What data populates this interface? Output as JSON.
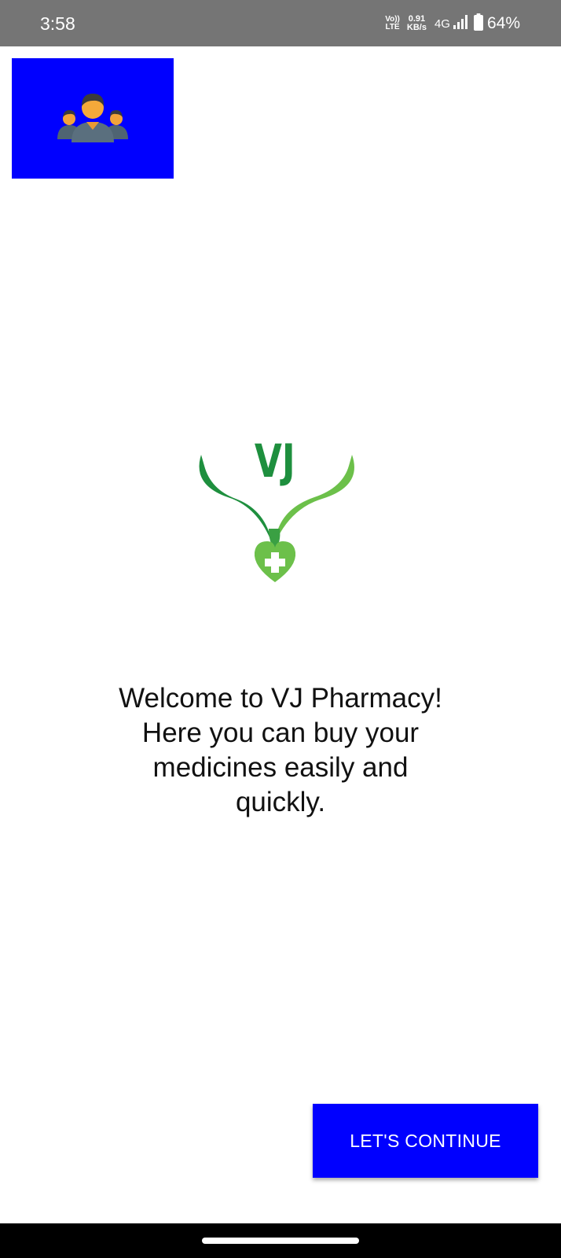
{
  "status_bar": {
    "time": "3:58",
    "volte_top": "Vo))",
    "volte_bottom": "LTE",
    "speed_value": "0.91",
    "speed_unit": "KB/s",
    "network": "4G",
    "battery": "64%",
    "icons": [
      "signal-icon",
      "battery-icon"
    ]
  },
  "profile_tile": {
    "icon": "group-users-icon",
    "color": "#0000ff"
  },
  "logo": {
    "text": "VJ",
    "colors": {
      "dark_green": "#1e8f3e",
      "light_green": "#6cc04a"
    }
  },
  "welcome_message": "Welcome to VJ Pharmacy!\nHere you can buy your\nmedicines easily and\nquickly.",
  "continue_button": {
    "label": "LET'S CONTINUE",
    "color": "#0000ff"
  }
}
